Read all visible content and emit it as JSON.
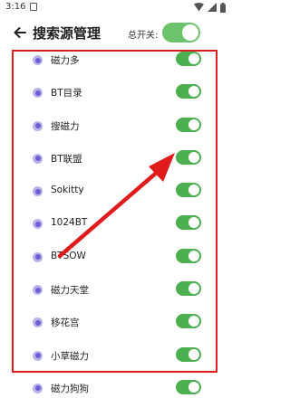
{
  "status_bar": {
    "time": "3:16"
  },
  "header": {
    "title": "搜索源管理",
    "master_switch_label": "总开关:",
    "master_switch_on": true
  },
  "sources": [
    {
      "name": "磁力多",
      "enabled": true
    },
    {
      "name": "BT目录",
      "enabled": true
    },
    {
      "name": "搜磁力",
      "enabled": true
    },
    {
      "name": "BT联盟",
      "enabled": true
    },
    {
      "name": "Sokitty",
      "enabled": true
    },
    {
      "name": "1024BT",
      "enabled": true
    },
    {
      "name": "BTSOW",
      "enabled": true
    },
    {
      "name": "磁力天堂",
      "enabled": true
    },
    {
      "name": "移花宫",
      "enabled": true
    },
    {
      "name": "小草磁力",
      "enabled": true
    },
    {
      "name": "磁力狗狗",
      "enabled": true
    }
  ],
  "colors": {
    "toggle_on": "#4caf50",
    "highlight": "#e01b1b",
    "source_icon": "#6b5fd3"
  },
  "icons": {
    "back": "arrow-left-icon",
    "source": "radio-dot-icon"
  }
}
